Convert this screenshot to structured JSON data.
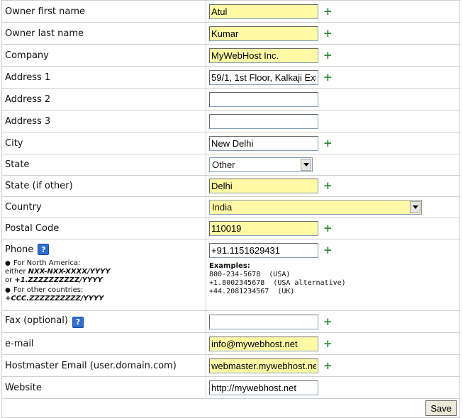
{
  "fields": {
    "owner_first_name": {
      "label": "Owner first name",
      "value": "Atul",
      "required": true
    },
    "owner_last_name": {
      "label": "Owner last name",
      "value": "Kumar",
      "required": true
    },
    "company": {
      "label": "Company",
      "value": "MyWebHost Inc.",
      "required": true
    },
    "address1": {
      "label": "Address 1",
      "value": "59/1, 1st Floor, Kalkaji Ext",
      "required": true
    },
    "address2": {
      "label": "Address 2",
      "value": ""
    },
    "address3": {
      "label": "Address 3",
      "value": ""
    },
    "city": {
      "label": "City",
      "value": "New Delhi",
      "required": true
    },
    "state": {
      "label": "State",
      "selected": "Other"
    },
    "state_other": {
      "label": "State (if other)",
      "value": "Delhi",
      "required": true
    },
    "country": {
      "label": "Country",
      "selected": "India"
    },
    "postal_code": {
      "label": "Postal Code",
      "value": "110019",
      "required": true
    },
    "phone": {
      "label": "Phone",
      "value": "+91.1151629431",
      "required": true
    },
    "fax": {
      "label": "Fax (optional)",
      "value": "",
      "required": true
    },
    "email": {
      "label": "e-mail",
      "value": "info@mywebhost.net",
      "required": true
    },
    "hostmaster_email": {
      "label": "Hostmaster Email (user.domain.com)",
      "value": "webmaster.mywebhost.net",
      "required": true
    },
    "website": {
      "label": "Website",
      "value": "http://mywebhost.net"
    }
  },
  "required_marker": "+",
  "help_icon": "?",
  "phone_notes": {
    "bullet": "●",
    "na_heading": "For North America:",
    "na_line1_prefix": "either ",
    "na_line1_format": "NXX-NXX-XXXX/YYYY",
    "na_line2_prefix": "or ",
    "na_line2_format": "+1.ZZZZZZZZZZ/YYYY",
    "other_heading": "For other countries:",
    "other_format": "+CCC.ZZZZZZZZZZ/YYYY"
  },
  "phone_examples": {
    "title": "Examples:",
    "lines": [
      "800-234-5678  (USA)",
      "+1.8002345678  (USA alternative)",
      "+44.2081234567  (UK)"
    ]
  },
  "save_label": "Save",
  "colors": {
    "required_bg": "#fff9a5",
    "plus": "#2e8b3a",
    "help": "#2f6fd1"
  }
}
